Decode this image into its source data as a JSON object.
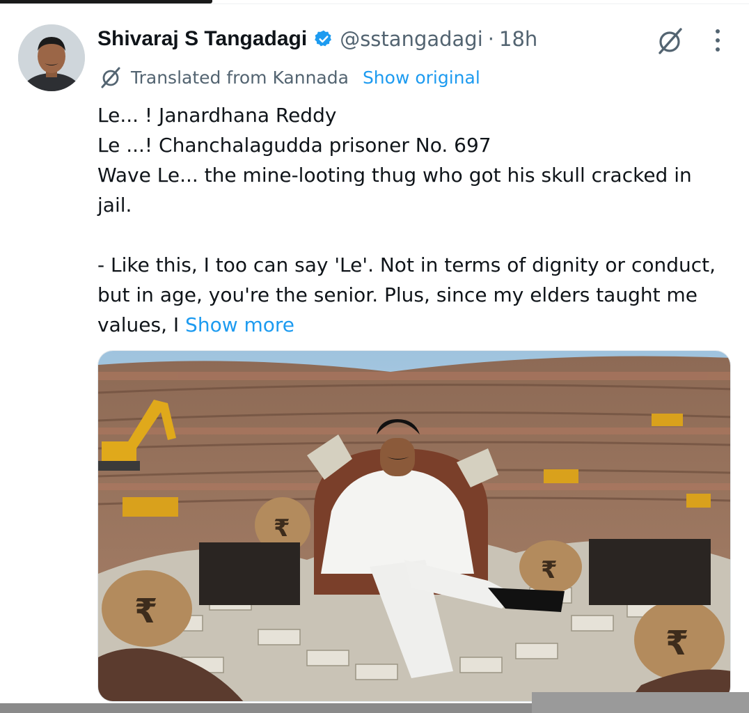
{
  "tweet": {
    "author_name": "Shivaraj S Tangadagi",
    "handle": "@sstangadagi",
    "separator": "·",
    "time": "18h",
    "translation_note": "Translated from Kannada",
    "show_original_label": "Show original",
    "lines": [
      "Le... ! Janardhana Reddy",
      "Le ...! Chanchalagudda prisoner No. 697",
      "Wave Le... the mine-looting thug who got his skull cracked in jail."
    ],
    "paragraph2": "- Like this, I too can say 'Le'. Not in terms of dignity or conduct, but in age, you're the senior. Plus, since my elders taught me values, I",
    "show_more_label": "Show more"
  },
  "colors": {
    "link": "#1d9bf0",
    "muted": "#536471",
    "text": "#0f1419",
    "verified": "#1d9bf0"
  },
  "icons": {
    "verified": "verified-badge-icon",
    "grok": "grok-icon",
    "more": "more-options-icon",
    "translate": "translate-icon"
  }
}
